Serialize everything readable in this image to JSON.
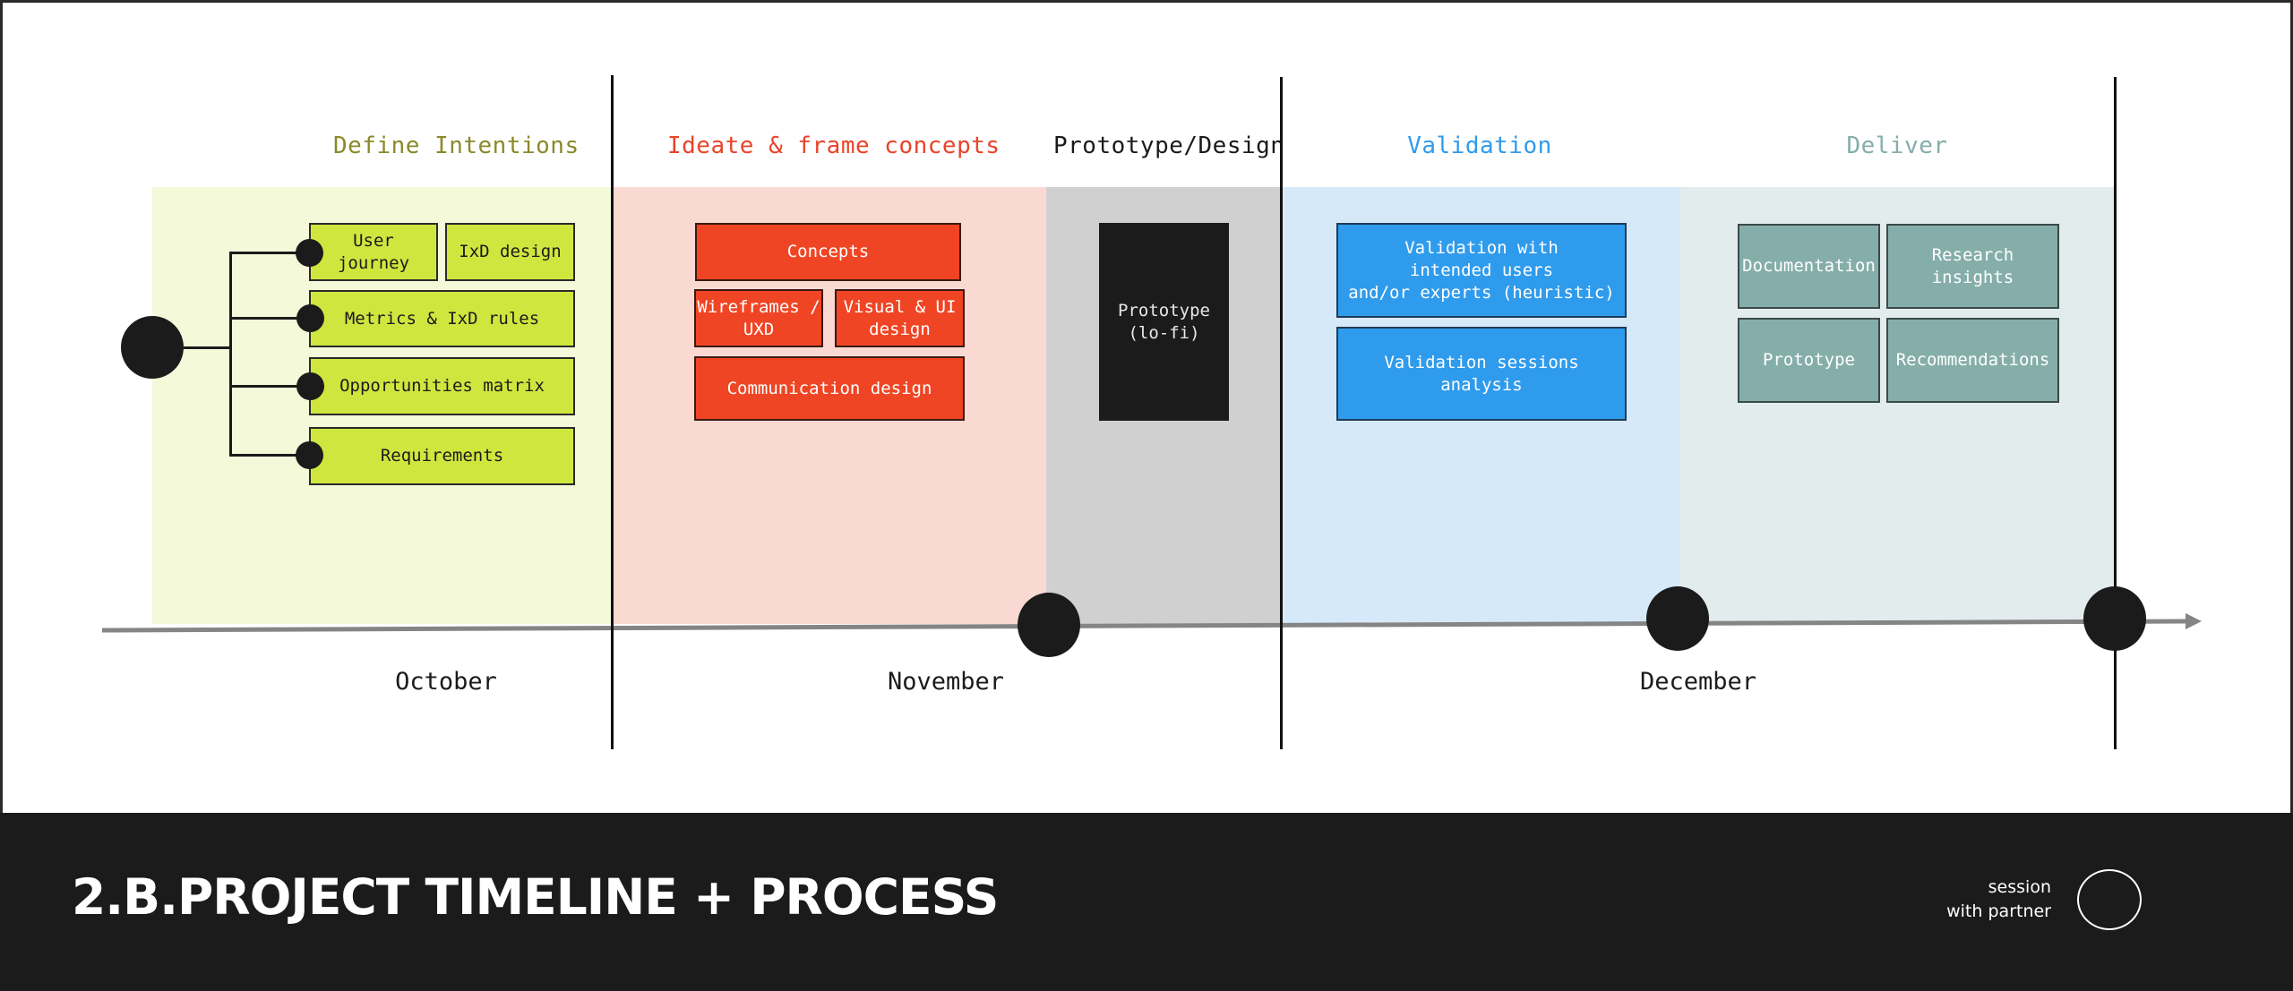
{
  "colors": {
    "define": "#8a8a2a",
    "ideate": "#e8442a",
    "prototype": "#1b1b1b",
    "validation": "#2f9bec",
    "deliver": "#85aeaa"
  },
  "phases": [
    {
      "title": "Define Intentions"
    },
    {
      "title": "Ideate & frame concepts"
    },
    {
      "title": "Prototype/Design"
    },
    {
      "title": "Validation"
    },
    {
      "title": "Deliver"
    }
  ],
  "define": {
    "user_journey": "User\njourney",
    "ixd_design": "IxD design",
    "metrics": "Metrics & IxD rules",
    "opportunities": "Opportunities matrix",
    "requirements": "Requirements"
  },
  "ideate": {
    "concepts": "Concepts",
    "wireframes": "Wireframes /\nUXD",
    "visual_ui": "Visual & UI\ndesign",
    "communication": "Communication design"
  },
  "prototype": {
    "lofi": "Prototype\n(lo-fi)"
  },
  "validation": {
    "with_users": "Validation with\nintended users\nand/or experts (heuristic)",
    "sessions": "Validation sessions\nanalysis"
  },
  "deliver": {
    "documentation": "Documentation",
    "research": "Research\ninsights",
    "prototype": "Prototype",
    "recommendations": "Recommendations"
  },
  "timeline": {
    "months": [
      "October",
      "November",
      "December"
    ]
  },
  "footer": {
    "title": "2.B.PROJECT TIMELINE + PROCESS",
    "legend_label": "session\nwith partner"
  }
}
